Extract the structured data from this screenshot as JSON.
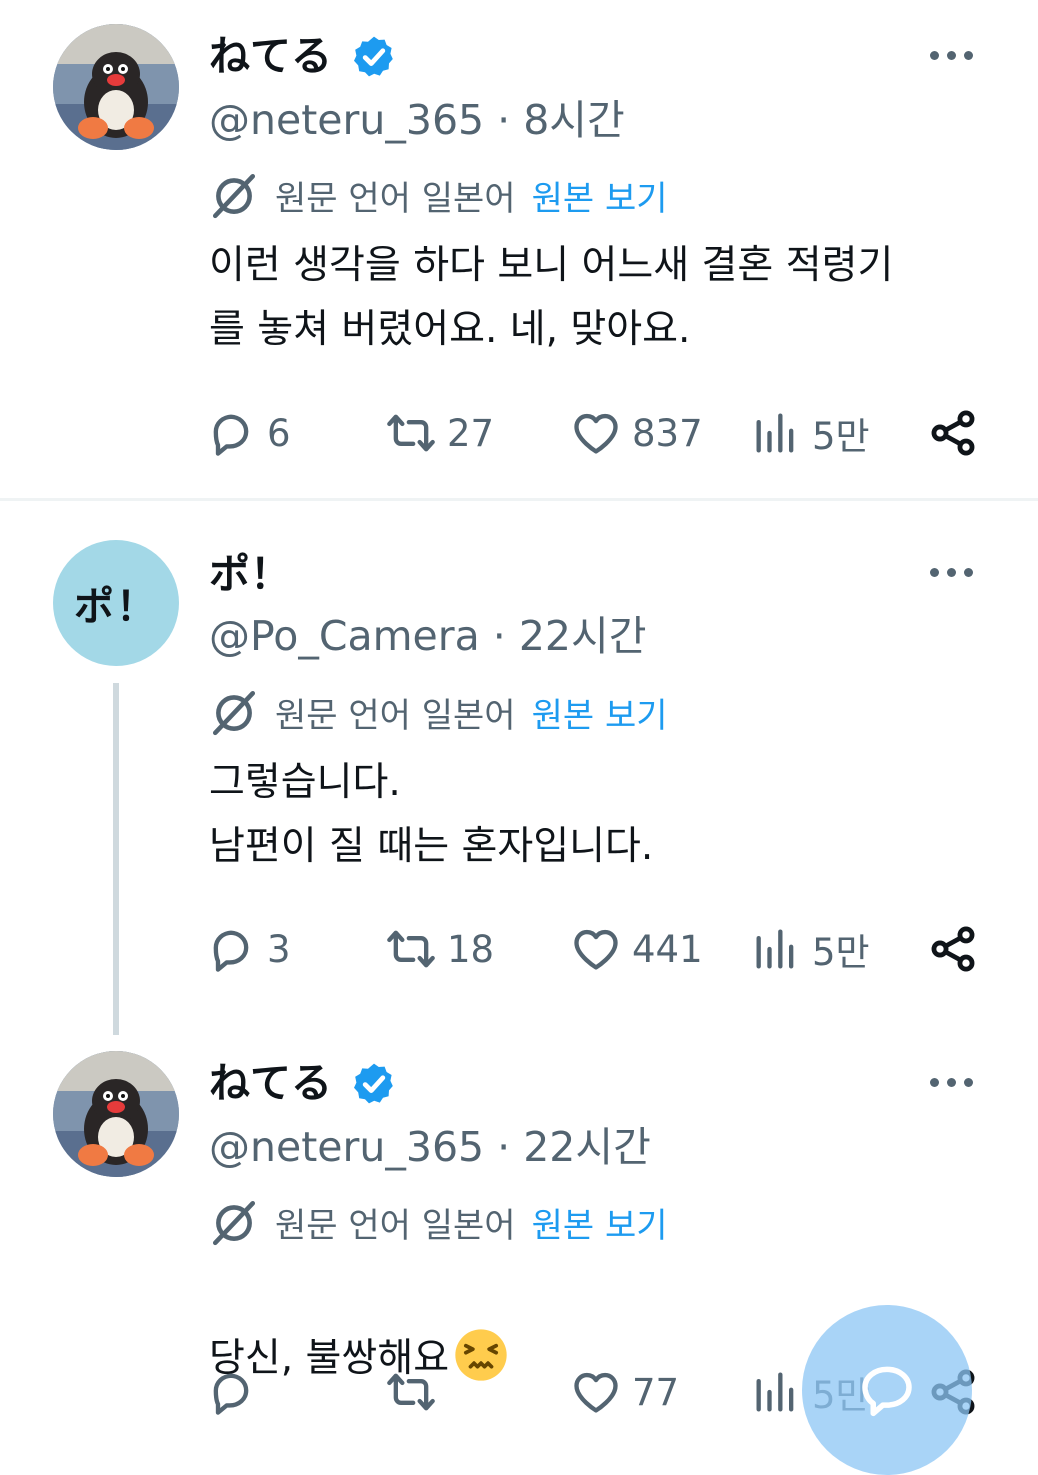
{
  "tweets": [
    {
      "author": "ねてる",
      "handle_time": "@neteru_365 · 8시간",
      "translate_label": "원문 언어 일본어",
      "translate_link": "원본 보기",
      "text": "이런 생각을 하다 보니 어느새 결혼 적령기\n를 놓쳐 버렸어요. 네, 맞아요.",
      "replies": "6",
      "reposts": "27",
      "likes": "837",
      "views": "5만"
    },
    {
      "author": "ポ！",
      "avatar_text": "ポ！",
      "handle_time": "@Po_Camera · 22시간",
      "translate_label": "원문 언어 일본어",
      "translate_link": "원본 보기",
      "text": "그렇습니다.\n남편이 질 때는 혼자입니다.",
      "replies": "3",
      "reposts": "18",
      "likes": "441",
      "views": "5만"
    },
    {
      "author": "ねてる",
      "handle_time": "@neteru_365 · 22시간",
      "translate_label": "원문 언어 일본어",
      "translate_link": "원본 보기",
      "text": "당신, 불쌍해요",
      "replies": "",
      "reposts": "",
      "likes": "77",
      "views": "5만"
    }
  ],
  "colors": {
    "accent": "#1d9bf0",
    "secondary_text": "#536471",
    "verified": "#1d9bf0",
    "po_avatar_bg": "#a3d8e7",
    "fab_bg": "#8cc6f4"
  },
  "icons": [
    "verified-badge-icon",
    "more-icon",
    "translate-icon",
    "reply-icon",
    "repost-icon",
    "like-icon",
    "views-icon",
    "share-icon",
    "compose-icon",
    "persevering-face-emoji"
  ]
}
